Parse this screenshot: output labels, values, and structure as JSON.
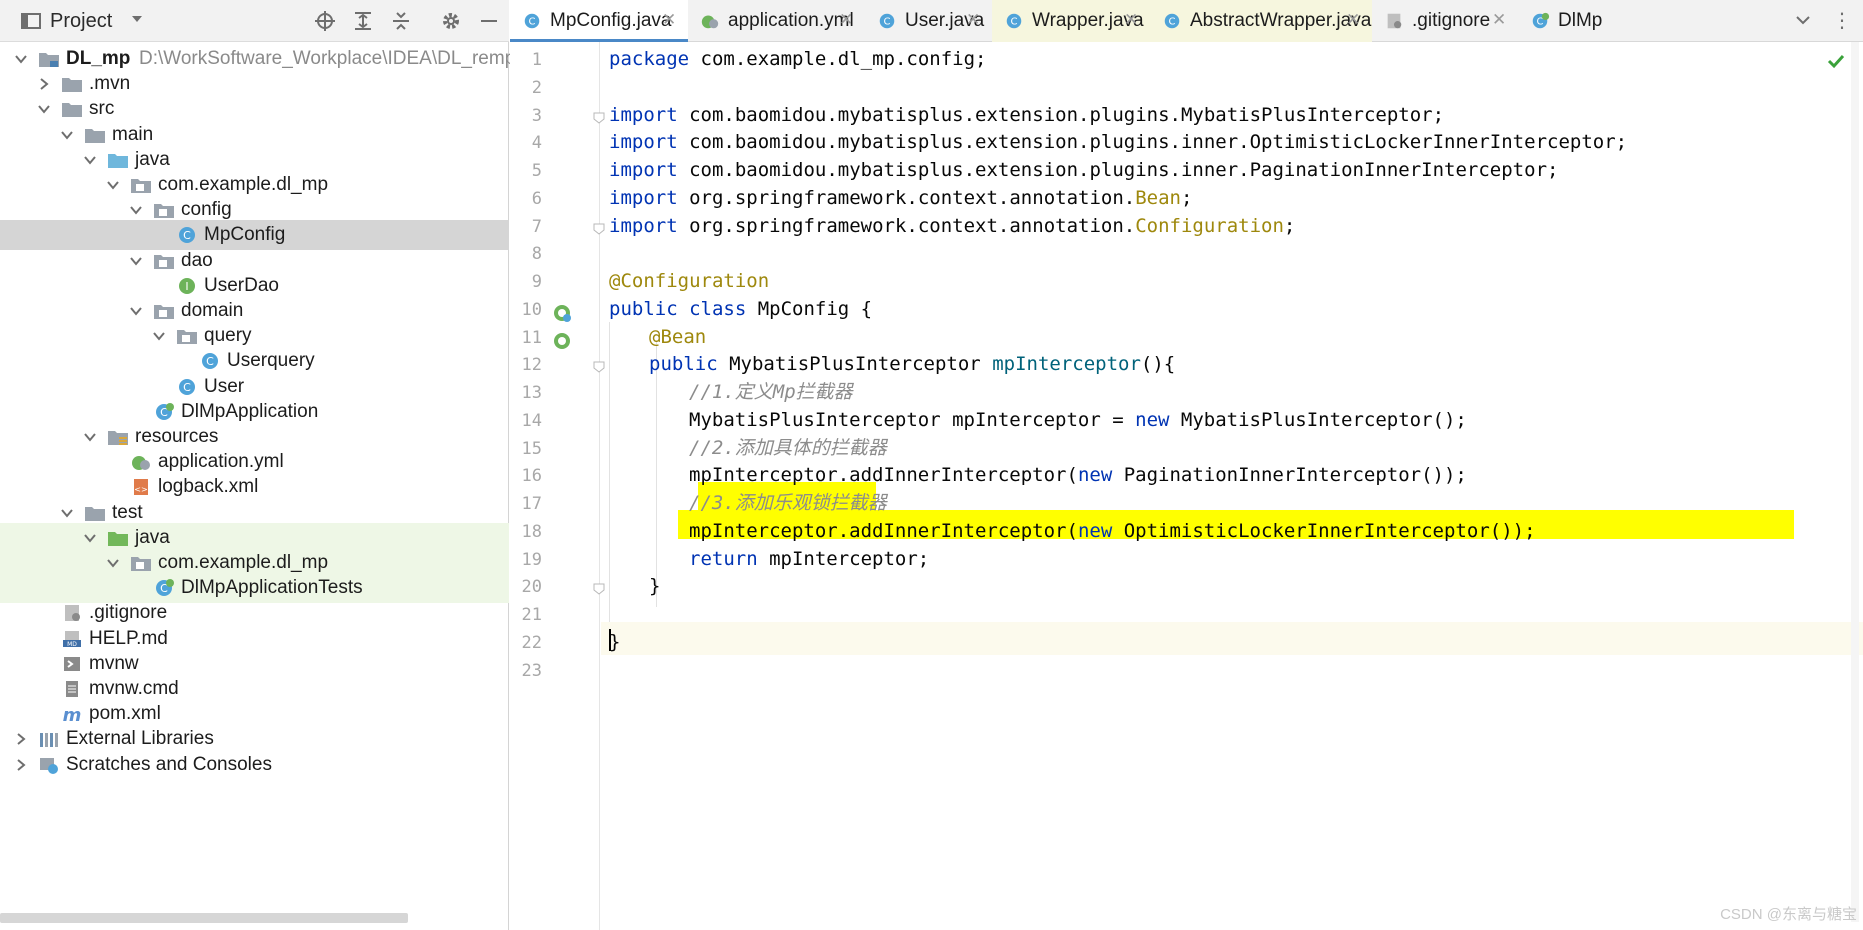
{
  "project_panel": {
    "title": "Project",
    "root_name": "DL_mp",
    "root_path": "D:\\WorkSoftware_Workplace\\IDEA\\DL_remp",
    "items": [
      {
        "label": ".mvn",
        "icon": "folder-icon"
      },
      {
        "label": "src",
        "icon": "folder-icon"
      },
      {
        "label": "main",
        "icon": "folder-icon"
      },
      {
        "label": "java",
        "icon": "source-folder-icon"
      },
      {
        "label": "com.example.dl_mp",
        "icon": "package-icon"
      },
      {
        "label": "config",
        "icon": "package-icon"
      },
      {
        "label": "MpConfig",
        "icon": "class-icon"
      },
      {
        "label": "dao",
        "icon": "package-icon"
      },
      {
        "label": "UserDao",
        "icon": "interface-icon"
      },
      {
        "label": "domain",
        "icon": "package-icon"
      },
      {
        "label": "query",
        "icon": "package-icon"
      },
      {
        "label": "Userquery",
        "icon": "class-icon"
      },
      {
        "label": "User",
        "icon": "class-icon"
      },
      {
        "label": "DlMpApplication",
        "icon": "spring-class-icon"
      },
      {
        "label": "resources",
        "icon": "resources-folder-icon"
      },
      {
        "label": "application.yml",
        "icon": "yaml-icon"
      },
      {
        "label": "logback.xml",
        "icon": "xml-icon"
      },
      {
        "label": "test",
        "icon": "folder-icon"
      },
      {
        "label": "java",
        "icon": "test-folder-icon"
      },
      {
        "label": "com.example.dl_mp",
        "icon": "package-icon"
      },
      {
        "label": "DlMpApplicationTests",
        "icon": "spring-class-icon"
      },
      {
        "label": ".gitignore",
        "icon": "gitignore-icon"
      },
      {
        "label": "HELP.md",
        "icon": "markdown-icon"
      },
      {
        "label": "mvnw",
        "icon": "shell-icon"
      },
      {
        "label": "mvnw.cmd",
        "icon": "text-file-icon"
      },
      {
        "label": "pom.xml",
        "icon": "maven-icon"
      },
      {
        "label": "External Libraries",
        "icon": "libraries-icon"
      },
      {
        "label": "Scratches and Consoles",
        "icon": "scratches-icon"
      }
    ]
  },
  "tabs": [
    {
      "label": "MpConfig.java",
      "icon": "class-icon",
      "active": true
    },
    {
      "label": "application.yml",
      "icon": "yaml-icon",
      "active": false
    },
    {
      "label": "User.java",
      "icon": "class-icon",
      "active": false
    },
    {
      "label": "Wrapper.java",
      "icon": "class-icon",
      "active": false
    },
    {
      "label": "AbstractWrapper.java",
      "icon": "class-icon",
      "active": false
    },
    {
      "label": ".gitignore",
      "icon": "gitignore-icon",
      "active": false
    },
    {
      "label": "DlMp",
      "icon": "spring-class-icon",
      "active": false
    }
  ],
  "line_numbers": [
    "1",
    "2",
    "3",
    "4",
    "5",
    "6",
    "7",
    "8",
    "9",
    "10",
    "11",
    "12",
    "13",
    "14",
    "15",
    "16",
    "17",
    "18",
    "19",
    "20",
    "21",
    "22",
    "23"
  ],
  "code": {
    "l1": {
      "kw": "package",
      "rest": " com.example.dl_mp.config;"
    },
    "l3": {
      "kw": "import",
      "rest": " com.baomidou.mybatisplus.extension.plugins.MybatisPlusInterceptor;"
    },
    "l4": {
      "kw": "import",
      "rest": " com.baomidou.mybatisplus.extension.plugins.inner.OptimisticLockerInnerInterceptor;"
    },
    "l5": {
      "kw": "import",
      "rest": " com.baomidou.mybatisplus.extension.plugins.inner.PaginationInnerInterceptor;"
    },
    "l6": {
      "kw": "import",
      "pre": " org.springframework.context.annotation.",
      "ann": "Bean",
      "post": ";"
    },
    "l7": {
      "kw": "import",
      "pre": " org.springframework.context.annotation.",
      "ann": "Configuration",
      "post": ";"
    },
    "l9": {
      "ann": "@Configuration"
    },
    "l10": {
      "kw": "public class",
      "rest": " MpConfig {"
    },
    "l11": {
      "ann": "@Bean"
    },
    "l12": {
      "kw": "public",
      "pre": " MybatisPlusInterceptor ",
      "fn": "mpInterceptor",
      "post": "(){"
    },
    "l13": {
      "cmt": "//1.定义Mp拦截器"
    },
    "l14": {
      "pre": "MybatisPlusInterceptor mpInterceptor = ",
      "kw": "new",
      "post": " MybatisPlusInterceptor();"
    },
    "l15": {
      "cmt": "//2.添加具体的拦截器"
    },
    "l16": {
      "pre": "mpInterceptor.addInnerInterceptor(",
      "kw": "new",
      "post": " PaginationInnerInterceptor());"
    },
    "l17": {
      "cmt": "//3.添加乐观锁拦截器"
    },
    "l18": {
      "pre": "mpInterceptor.addInnerInterceptor(",
      "kw": "new",
      "post": " OptimisticLockerInnerInterceptor());"
    },
    "l19": {
      "kw": "return",
      "rest": " mpInterceptor;"
    },
    "l20": {
      "brace": "}"
    },
    "l22": {
      "brace": "}"
    }
  },
  "watermark": "CSDN @东离与糖宝",
  "colors": {
    "keyword": "#0033b3",
    "annotation": "#9e880d",
    "comment": "#8c8c8c",
    "highlight": "#ffff00",
    "selection": "#d5d5d5",
    "active_tab_underline": "#4a88c7"
  }
}
